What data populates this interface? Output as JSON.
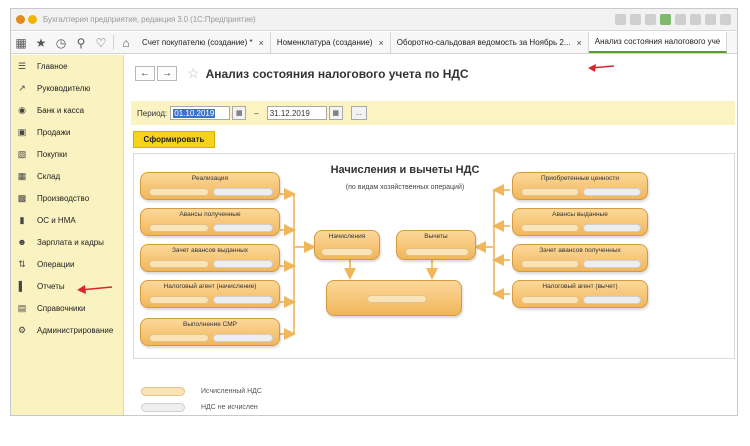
{
  "window": {
    "title": "Бухгалтерия предприятия, редакция 3.0 (1С:Предприятие)"
  },
  "tabs": [
    {
      "label": "Счет покупателю (создание) *",
      "active": false
    },
    {
      "label": "Номенклатура (создание)",
      "active": false
    },
    {
      "label": "Оборотно-сальдовая ведомость за Ноябрь 2...",
      "active": false
    },
    {
      "label": "Анализ состояния налогового уче",
      "active": true
    }
  ],
  "sidebar": {
    "items": [
      {
        "label": "Главное",
        "icon": "menu-icon"
      },
      {
        "label": "Руководителю",
        "icon": "trend-icon"
      },
      {
        "label": "Банк и касса",
        "icon": "bank-icon"
      },
      {
        "label": "Продажи",
        "icon": "sales-icon"
      },
      {
        "label": "Покупки",
        "icon": "cart-icon"
      },
      {
        "label": "Склад",
        "icon": "warehouse-icon"
      },
      {
        "label": "Производство",
        "icon": "factory-icon"
      },
      {
        "label": "ОС и НМА",
        "icon": "truck-icon"
      },
      {
        "label": "Зарплата и кадры",
        "icon": "people-icon"
      },
      {
        "label": "Операции",
        "icon": "operations-icon"
      },
      {
        "label": "Отчеты",
        "icon": "chart-icon"
      },
      {
        "label": "Справочники",
        "icon": "books-icon"
      },
      {
        "label": "Администрирование",
        "icon": "gear-icon"
      }
    ]
  },
  "page": {
    "title": "Анализ состояния налогового учета по НДС",
    "period_label": "Период:",
    "date_from": "01.10.2019",
    "date_to": "31.12.2019",
    "dash": "–",
    "more_label": "...",
    "generate_label": "Сформировать"
  },
  "diagram": {
    "title": "Начисления и вычеты НДС",
    "subtitle": "(по видам хозяйственных операций)",
    "left_boxes": [
      "Реализация",
      "Авансы полученные",
      "Зачет авансов выданных",
      "Налоговый агент (начисление)",
      "Выполнение СМР"
    ],
    "right_boxes": [
      "Приобретенные ценности",
      "Авансы выданные",
      "Зачет авансов полученных",
      "Налоговый агент (вычет)"
    ],
    "center_boxes": [
      "Начисления",
      "Вычеты"
    ]
  },
  "legend": {
    "calculated": "Исчисленный НДС",
    "not_calculated": "НДС не исчислен"
  },
  "colors": {
    "sidebar_bg": "#faf2c0",
    "button_yellow": "#f6d21a",
    "box_orange": "#f1b65a",
    "annotation_red": "#d9262b"
  }
}
